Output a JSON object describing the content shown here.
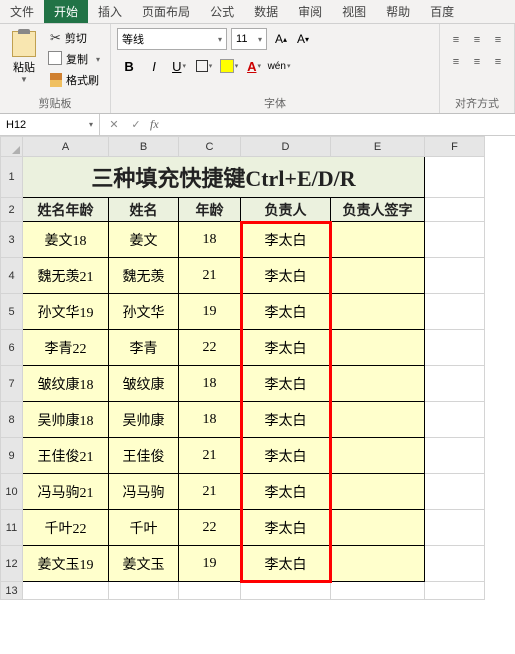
{
  "tabs": [
    "文件",
    "开始",
    "插入",
    "页面布局",
    "公式",
    "数据",
    "审阅",
    "视图",
    "帮助",
    "百度"
  ],
  "active_tab": 1,
  "clipboard": {
    "paste": "粘贴",
    "cut": "剪切",
    "copy": "复制",
    "format_painter": "格式刷",
    "group": "剪贴板"
  },
  "font": {
    "name": "等线",
    "size": "11",
    "group": "字体",
    "bold": "B",
    "italic": "I",
    "underline": "U",
    "ruby": "wén"
  },
  "align": {
    "group": "对齐方式"
  },
  "namebox": "H12",
  "columns": [
    "A",
    "B",
    "C",
    "D",
    "E",
    "F"
  ],
  "rows_vis": 13,
  "title": "三种填充快捷键Ctrl+E/D/R",
  "headers": [
    "姓名年龄",
    "姓名",
    "年龄",
    "负责人",
    "负责人签字"
  ],
  "data": [
    [
      "姜文18",
      "姜文",
      "18",
      "李太白",
      ""
    ],
    [
      "魏无羡21",
      "魏无羡",
      "21",
      "李太白",
      ""
    ],
    [
      "孙文华19",
      "孙文华",
      "19",
      "李太白",
      ""
    ],
    [
      "李青22",
      "李青",
      "22",
      "李太白",
      ""
    ],
    [
      "皱纹康18",
      "皱纹康",
      "18",
      "李太白",
      ""
    ],
    [
      "吴帅康18",
      "吴帅康",
      "18",
      "李太白",
      ""
    ],
    [
      "王佳俊21",
      "王佳俊",
      "21",
      "李太白",
      ""
    ],
    [
      "冯马驹21",
      "冯马驹",
      "21",
      "李太白",
      ""
    ],
    [
      "千叶22",
      "千叶",
      "22",
      "李太白",
      ""
    ],
    [
      "姜文玉19",
      "姜文玉",
      "19",
      "李太白",
      ""
    ]
  ]
}
